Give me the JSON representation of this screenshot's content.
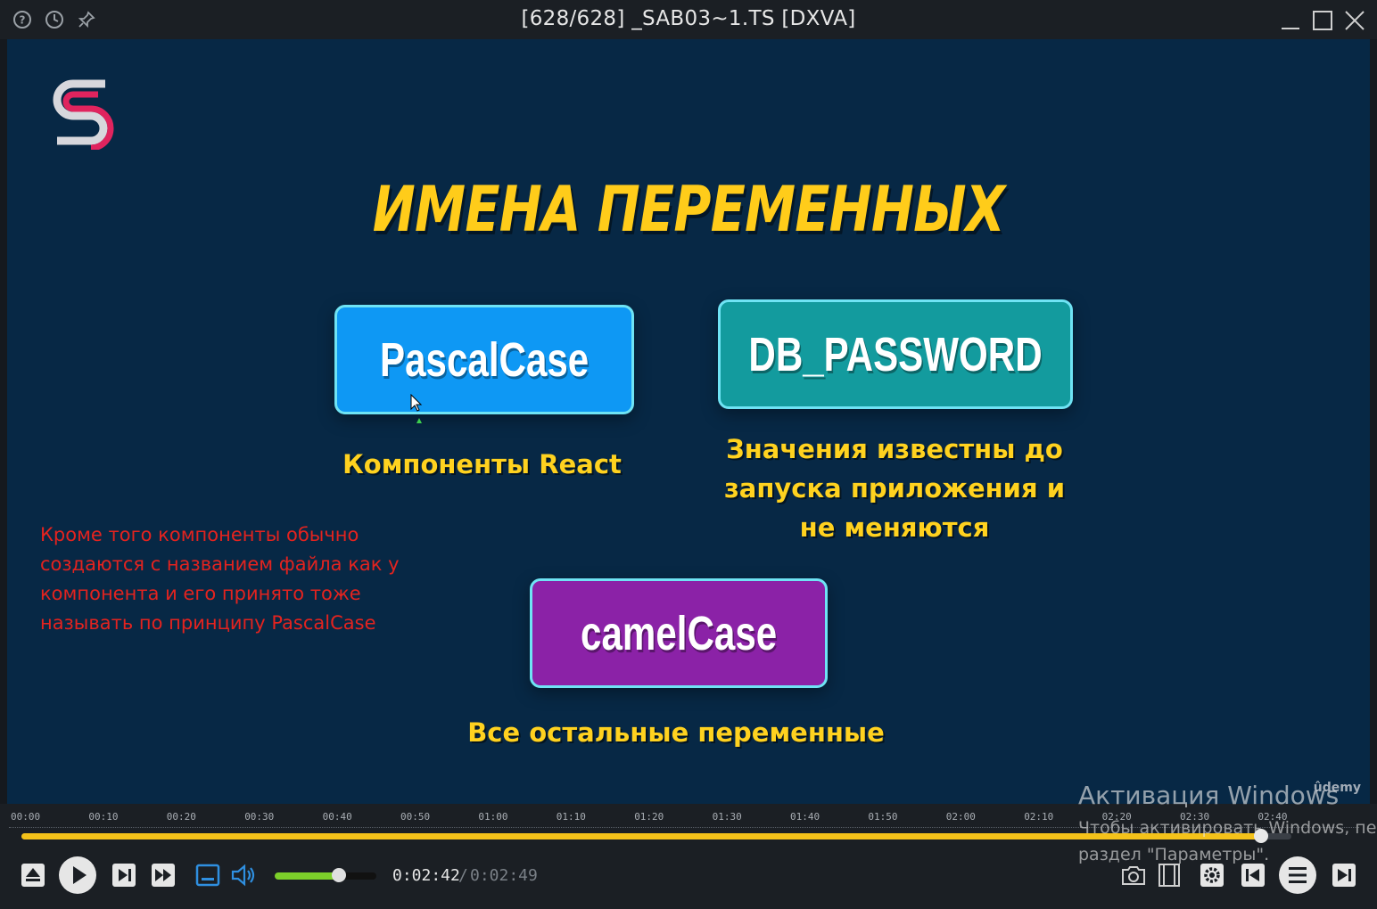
{
  "window": {
    "title": "[628/628] _SAB03~1.TS [DXVA]",
    "icons": [
      "help-icon",
      "clock-icon",
      "pin-icon"
    ],
    "buttons": [
      "minimize",
      "maximize",
      "close"
    ]
  },
  "slide": {
    "headline": "ИМЕНА ПЕРЕМЕННЫХ",
    "cards": [
      {
        "label": "PascalCase",
        "caption": "Компоненты React",
        "color": "#0e98f4"
      },
      {
        "label": "DB_PASSWORD",
        "caption_lines": [
          "Значения известны до",
          "запуска приложения и",
          "не меняются"
        ],
        "color": "#139b9e"
      },
      {
        "label": "camelCase",
        "caption": "Все остальные переменные",
        "color": "#8b22a7"
      }
    ],
    "note_lines": [
      "Кроме того компоненты обычно",
      "создаются с названием файла как у",
      "компонента и его принято тоже",
      "называть по принципу PascalCase"
    ],
    "watermark": "ûdemy",
    "headline_color": "#ffcc1a",
    "caption_color": "#ffd21f",
    "note_color": "#e3231f"
  },
  "timeline": {
    "ticks": [
      "00:00",
      "00:10",
      "00:20",
      "00:30",
      "00:40",
      "00:50",
      "01:00",
      "01:10",
      "01:20",
      "01:30",
      "01:40",
      "01:50",
      "02:00",
      "02:10",
      "02:20",
      "02:30",
      "02:40"
    ],
    "progress_fraction": 0.976,
    "accent": "#f4c21a"
  },
  "controls": {
    "current_time": "0:02:42",
    "separator": "/",
    "total_time": "0:02:49",
    "volume_fraction": 0.63,
    "volume_color": "#7ccf2a"
  },
  "activation": {
    "line1": "Активация Windows",
    "line2": "Чтобы активировать Windows, пе",
    "line3": "раздел \"Параметры\"."
  }
}
